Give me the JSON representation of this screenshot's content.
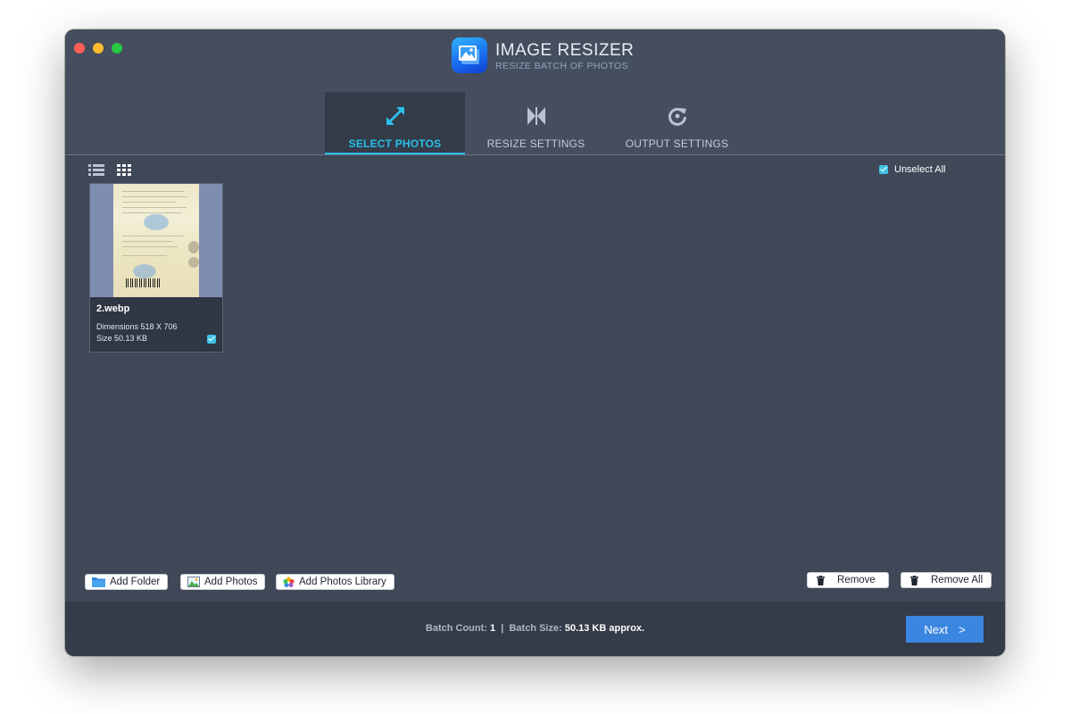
{
  "app": {
    "title": "IMAGE RESIZER",
    "subtitle": "RESIZE BATCH OF PHOTOS"
  },
  "tabs": [
    {
      "label": "SELECT PHOTOS",
      "icon": "expand-arrows-icon",
      "active": true
    },
    {
      "label": "RESIZE SETTINGS",
      "icon": "resize-bowtie-icon",
      "active": false
    },
    {
      "label": "OUTPUT SETTINGS",
      "icon": "refresh-output-icon",
      "active": false
    }
  ],
  "toolbar": {
    "list_view_icon": "list-view-icon",
    "grid_view_icon": "grid-view-icon",
    "active_view": "grid",
    "unselect_all_label": "Unselect All",
    "unselect_all_checked": true
  },
  "photos": [
    {
      "name": "2.webp",
      "dimensions": "Dimensions 518 X 706",
      "size": "Size 50.13 KB",
      "checked": true
    }
  ],
  "actions": {
    "add_folder": "Add Folder",
    "add_photos": "Add Photos",
    "add_photos_library": "Add Photos Library",
    "remove": "Remove",
    "remove_all": "Remove All"
  },
  "footer": {
    "batch_count_label": "Batch Count:",
    "batch_count_value": "1",
    "separator": "|",
    "batch_size_label": "Batch Size:",
    "batch_size_value": "50.13 KB approx.",
    "next_label": "Next",
    "next_glyph": ">"
  },
  "colors": {
    "accent": "#29c0ea",
    "window_bg": "#404858",
    "primary_button": "#3a86e0"
  }
}
